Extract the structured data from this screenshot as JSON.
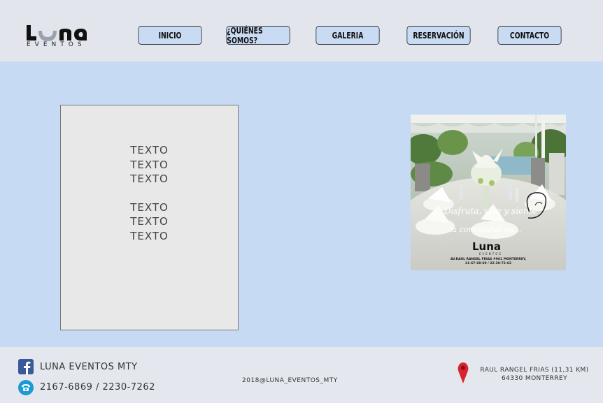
{
  "brand": {
    "logo_text": "Luna",
    "logo_subtext": "EVENTOS"
  },
  "nav": {
    "items": [
      {
        "label": "INICIO"
      },
      {
        "label": "¿QUIÉNES SOMOS?"
      },
      {
        "label": "GALERIA"
      },
      {
        "label": "RESERVACIÓN"
      },
      {
        "label": "CONTACTO"
      }
    ]
  },
  "main": {
    "text_box": {
      "lines": [
        "TEXTO",
        "TEXTO",
        "TEXTO",
        "TEXTO",
        "TEXTO",
        "TEXTO"
      ]
    },
    "promo": {
      "tagline_1": "Disfruta, vive y siente",
      "tagline_2": "la comodidad en...",
      "logo_text": "Luna",
      "logo_subtext": "EVENTOS",
      "address": "AV.RAUL RANGEL FRIAS #961 MONTERREY,",
      "phones": "21-67-68-69 / 22-30-72-62"
    }
  },
  "footer": {
    "facebook": "LUNA EVENTOS MTY",
    "phone": "2167-6869 / 2230-7262",
    "copyright": "2018@LUNA_EVENTOS_MTY",
    "address_line1": "RAUL RANGEL FRIAS (11,31 KM)",
    "address_line2": "64330 MONTERREY"
  },
  "colors": {
    "header_bg": "#e2e6ec",
    "main_bg": "#c6daf3",
    "button_bg": "#c9dbf3",
    "facebook_blue": "#3b5998",
    "phone_teal": "#1b9ad6",
    "pin_red": "#d9232e"
  },
  "icons": [
    "facebook-icon",
    "phone-icon",
    "map-pin-icon"
  ]
}
